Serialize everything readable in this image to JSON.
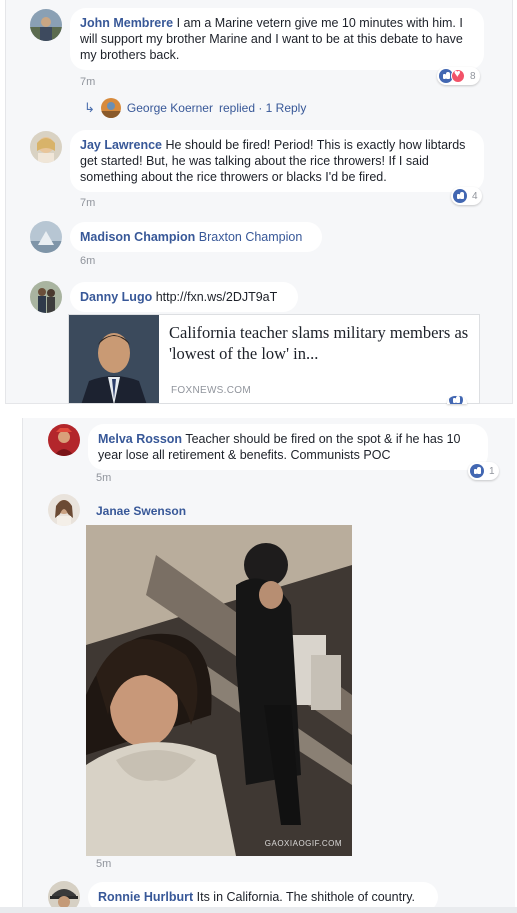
{
  "top_comments": [
    {
      "author": "John Membrere",
      "text": "I am a Marine vetern give me 10 minutes with him. I will support my brother Marine and I want to be at this debate to have my brothers back.",
      "time": "7m",
      "reaction_count": "8",
      "reactions": [
        "like-icon",
        "love-icon"
      ]
    },
    {
      "author": "Jay Lawrence",
      "text": "He should be fired! Period! This is exactly how libtards get started! But, he was talking about the rice throwers! If I said something about the rice throwers or blacks I'd be fired.",
      "time": "7m",
      "reaction_count": "4",
      "reactions": [
        "like-icon"
      ]
    },
    {
      "author": "Madison Champion",
      "text": "Braxton Champion",
      "time": "6m"
    },
    {
      "author": "Danny Lugo",
      "text": "http://fxn.ws/2DJT9aT"
    }
  ],
  "reply_summary": {
    "author": "George Koerner",
    "text": "replied · 1 Reply"
  },
  "link_preview": {
    "title": "California teacher slams military members as 'lowest of the low' in...",
    "domain": "FOXNEWS.COM"
  },
  "bottom_comments": [
    {
      "author": "Melva Rosson",
      "text": "Teacher should be fired on the spot & if he has 10 year lose all retirement & benefits. Communists POC",
      "time": "5m",
      "reaction_count": "1",
      "reactions": [
        "like-icon"
      ]
    },
    {
      "author": "Janae Swenson",
      "text": "",
      "time": "5m",
      "gif_watermark": "GAOXIAOGIF.COM"
    },
    {
      "author": "Ronnie Hurlburt",
      "text": "Its in California. The shithole of country."
    }
  ],
  "colors": {
    "author_link": "#385898",
    "like_blue": "#4267b2",
    "love_red": "#f25268",
    "panel_bg": "#f6f7f9",
    "meta_gray": "#90949c"
  }
}
